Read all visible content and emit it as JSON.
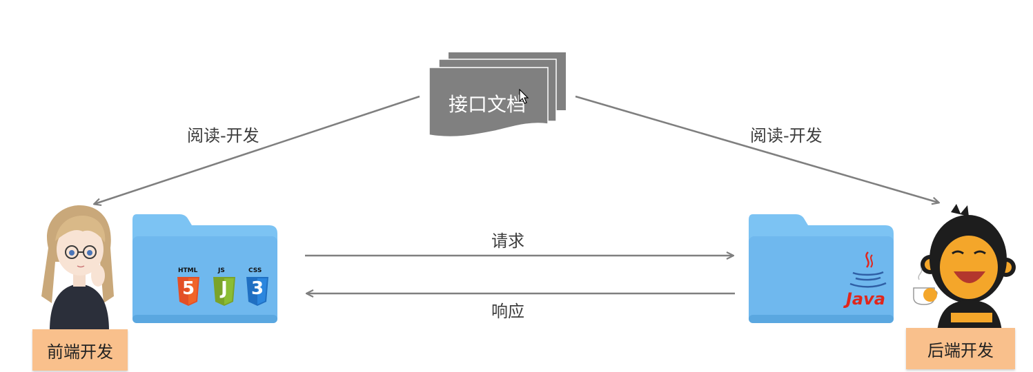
{
  "document": {
    "label": "接口文档"
  },
  "left_arrow": {
    "label": "阅读-开发"
  },
  "right_arrow": {
    "label": "阅读-开发"
  },
  "request": {
    "label": "请求"
  },
  "response": {
    "label": "响应"
  },
  "frontend": {
    "role_label": "前端开发",
    "badges": [
      "HTML",
      "JS",
      "CSS"
    ],
    "badge_numbers": [
      "5",
      "J",
      "3"
    ]
  },
  "backend": {
    "role_label": "后端开发",
    "logo_text": "Java"
  },
  "colors": {
    "document_fill": "#808080",
    "arrow": "#7f7f7f",
    "folder": "#7cc3f3",
    "role_box": "#f9c08c",
    "html5": "#e34f26",
    "js": "#7aa32a",
    "css3": "#1f6fc2",
    "java_red": "#e1261c"
  }
}
